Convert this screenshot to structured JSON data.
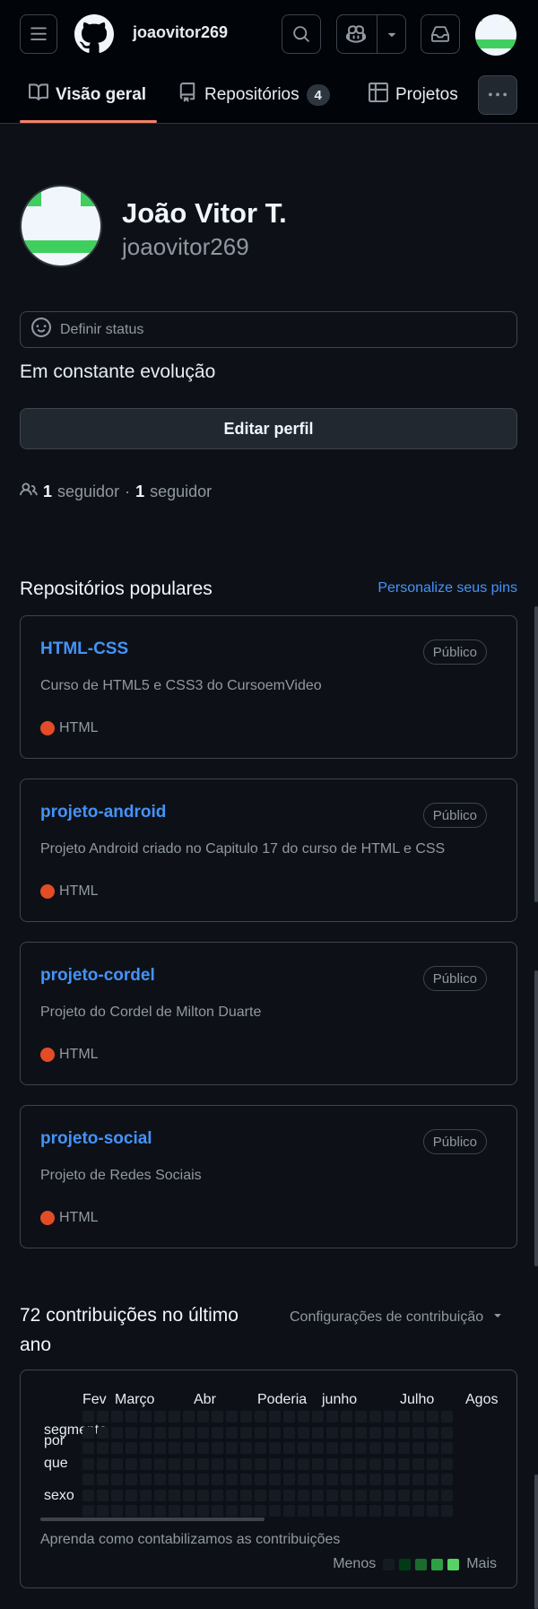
{
  "header": {
    "username": "joaovitor269",
    "colors": {
      "background": "#010409",
      "border": "#3d444d"
    },
    "icons": [
      "menu-icon",
      "github-logo-icon",
      "search-icon",
      "copilot-icon",
      "triangle-down-icon",
      "inbox-icon",
      "kebab-icon"
    ]
  },
  "tabs": [
    {
      "label": "Visão geral",
      "icon": "book-icon",
      "active": true
    },
    {
      "label": "Repositórios",
      "icon": "repo-icon",
      "count": "4"
    },
    {
      "label": "Projetos",
      "icon": "table-icon"
    }
  ],
  "profile": {
    "full_name": "João Vitor T.",
    "login": "joaovitor269",
    "status_label": "Definir status",
    "bio": "Em constante evolução",
    "edit_label": "Editar perfil",
    "followers_count": "1",
    "followers_label": "seguidor",
    "separator": "·",
    "following_count": "1",
    "following_label": "seguidor",
    "avatar_colors": {
      "light": "#f0f6fc",
      "green": "#3fcf5e"
    }
  },
  "popular": {
    "title": "Repositórios populares",
    "customize_label": "Personalize seus pins",
    "repos": [
      {
        "name": "HTML-CSS",
        "visibility": "Público",
        "description": "Curso de HTML5 e CSS3 do CursoemVideo",
        "language": "HTML",
        "language_color": "#e34c26"
      },
      {
        "name": "projeto-android",
        "visibility": "Público",
        "description": "Projeto Android criado no Capitulo 17 do curso de HTML e CSS",
        "language": "HTML",
        "language_color": "#e34c26"
      },
      {
        "name": "projeto-cordel",
        "visibility": "Público",
        "description": "Projeto do Cordel de Milton Duarte",
        "language": "HTML",
        "language_color": "#e34c26"
      },
      {
        "name": "projeto-social",
        "visibility": "Público",
        "description": "Projeto de Redes Sociais",
        "language": "HTML",
        "language_color": "#e34c26"
      }
    ]
  },
  "contributions": {
    "title": "72 contribuições no último ano",
    "settings_label": "Configurações de contribuição",
    "months": [
      "Fev",
      "Março",
      "Abr",
      "Poderia",
      "junho",
      "Julho",
      "Agos"
    ],
    "days": [
      "segmento",
      "por",
      "que",
      "sexo"
    ],
    "learn_label": "Aprenda como contabilizamos as contribuições",
    "legend_less": "Menos",
    "legend_more": "Mais",
    "legend_colors": [
      "#151b23",
      "#033a16",
      "#196c2e",
      "#2ea043",
      "#56d364"
    ],
    "empty_cell_color": "#151b23"
  }
}
